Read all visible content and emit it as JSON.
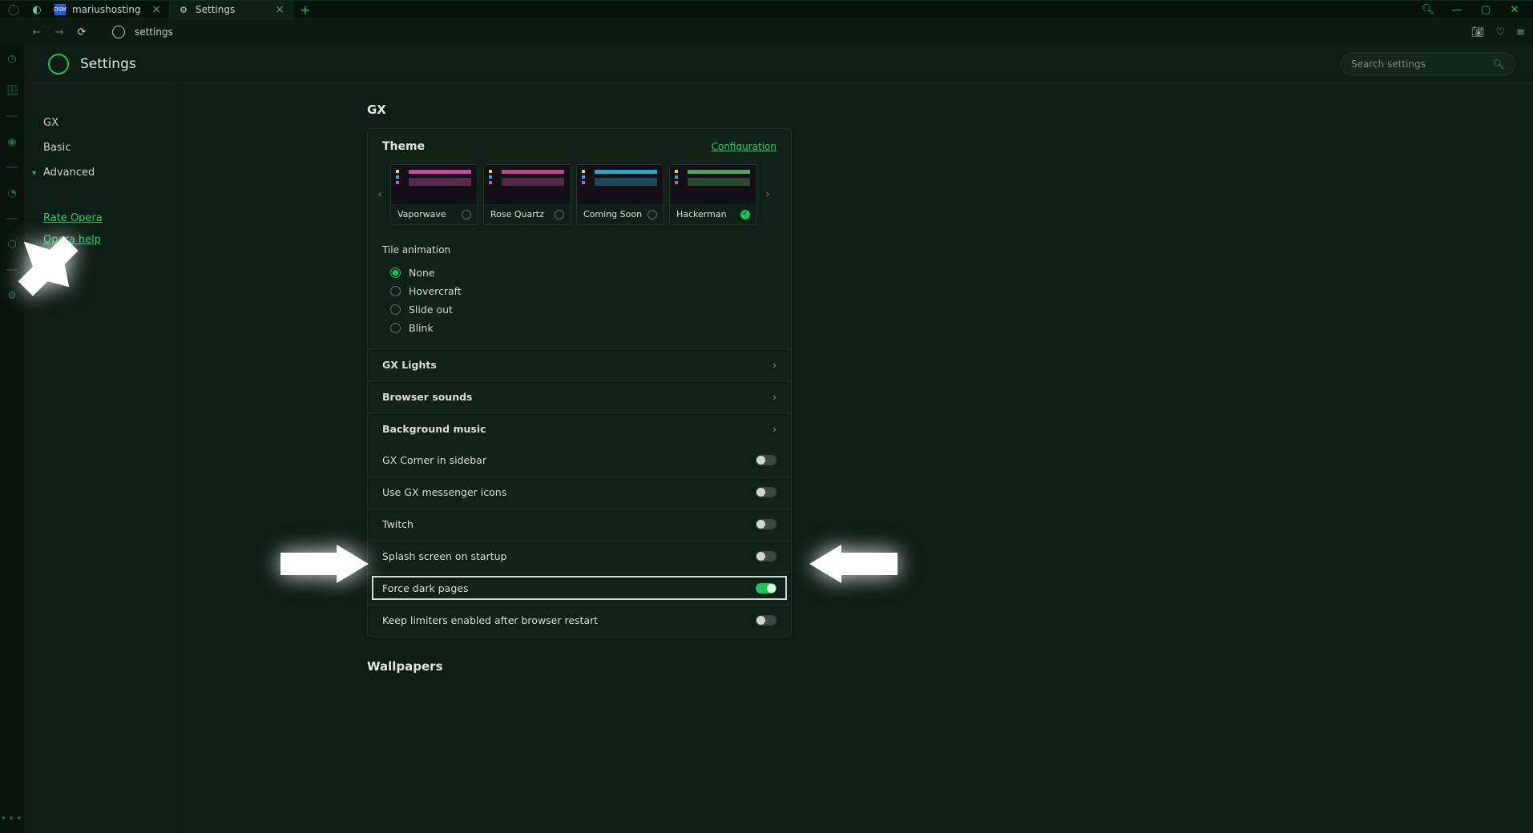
{
  "tabs": [
    {
      "title": "mariushosting",
      "icon_bg": "#2a5bd6",
      "icon_text": "DSM"
    },
    {
      "title": "Settings",
      "icon": "⚙"
    }
  ],
  "url": "settings",
  "header": {
    "title": "Settings",
    "search_placeholder": "Search settings"
  },
  "sidebar": {
    "items": [
      "GX",
      "Basic",
      "Advanced"
    ],
    "links": [
      "Rate Opera",
      "Opera help"
    ]
  },
  "gx": {
    "section": "GX",
    "theme_label": "Theme",
    "configuration": "Configuration",
    "themes": [
      {
        "name": "Vaporwave",
        "accent": "#d94fb3",
        "sel": false
      },
      {
        "name": "Rose Quartz",
        "accent": "#d34da0",
        "sel": false
      },
      {
        "name": "Coming Soon",
        "accent": "#2fb6d6",
        "sel": false
      },
      {
        "name": "Hackerman",
        "accent": "#56b36a",
        "sel": true
      }
    ],
    "tile_anim_label": "Tile animation",
    "tile_anim_options": [
      "None",
      "Hovercraft",
      "Slide out",
      "Blink"
    ],
    "tile_anim_selected": "None",
    "expandable": [
      "GX Lights",
      "Browser sounds",
      "Background music"
    ],
    "toggles": [
      {
        "label": "GX Corner in sidebar",
        "on": false
      },
      {
        "label": "Use GX messenger icons",
        "on": false
      },
      {
        "label": "Twitch",
        "on": false
      },
      {
        "label": "Splash screen on startup",
        "on": false
      },
      {
        "label": "Force dark pages",
        "on": true,
        "highlight": true
      },
      {
        "label": "Keep limiters enabled after browser restart",
        "on": false
      }
    ],
    "wallpapers_section": "Wallpapers"
  }
}
